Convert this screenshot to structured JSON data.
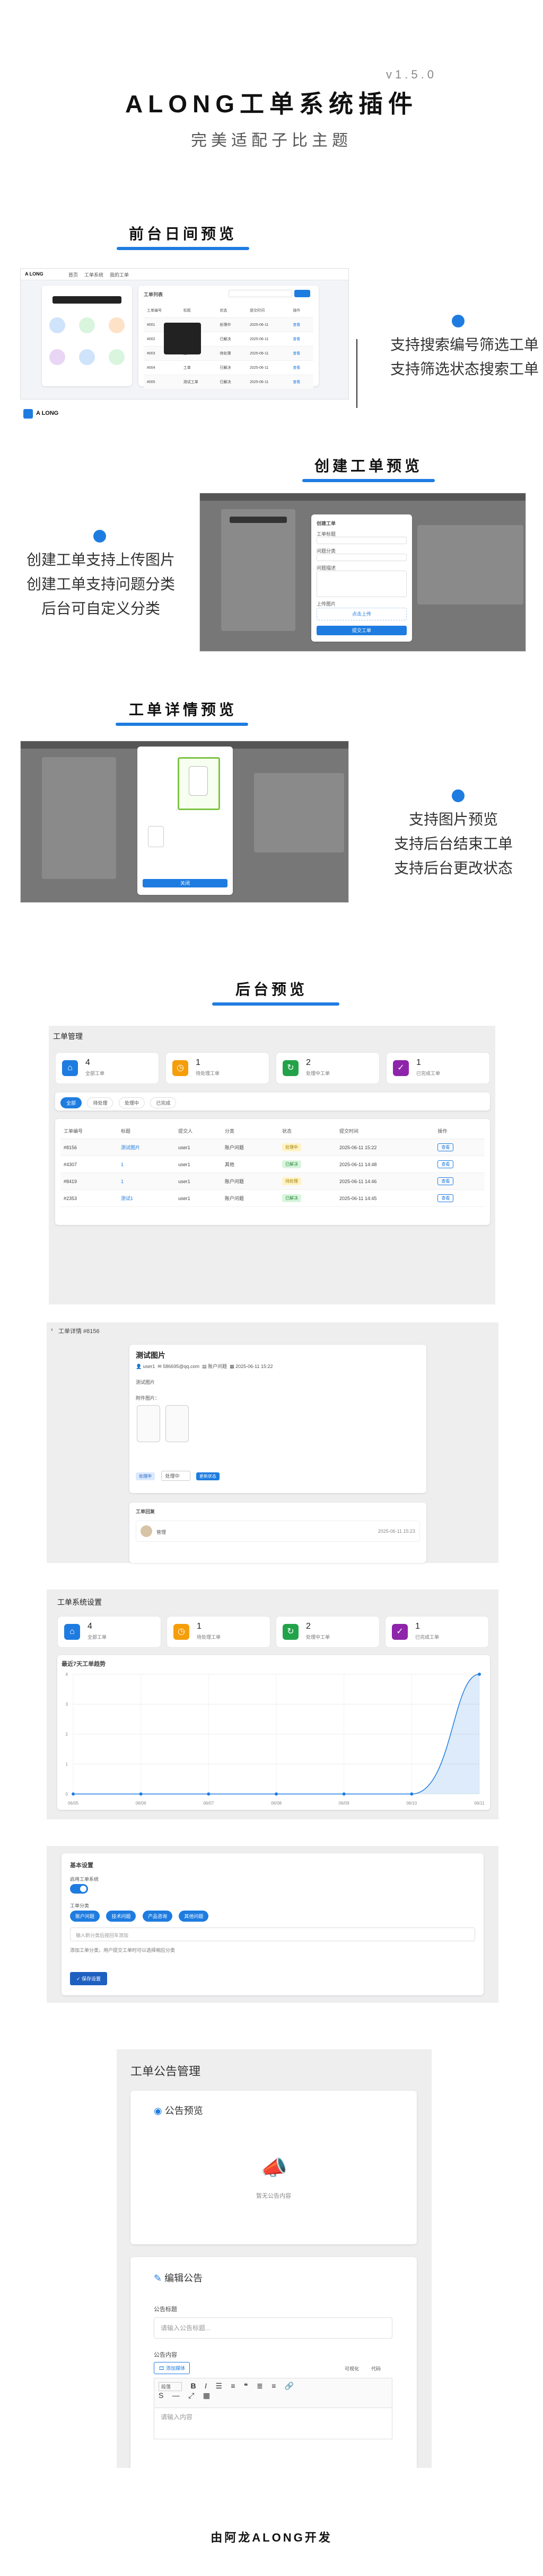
{
  "header": {
    "version": "v1.5.0",
    "title": "ALONG工单系统插件",
    "subtitle": "完美适配子比主题"
  },
  "sections": {
    "frontend": {
      "title": "前台日间预览",
      "features": [
        "支持搜索编号筛选工单",
        "支持筛选状态搜索工单"
      ],
      "shot": {
        "logo": "A LONG",
        "tabs": [
          "首页",
          "工单系统",
          "我的工单"
        ],
        "panel_title": "工单列表",
        "table_headers": [
          "工单编号",
          "标题",
          "状态",
          "提交时间",
          "操作"
        ],
        "rows": [
          [
            "#001",
            "测试工单",
            "处理中",
            "2025-06-11",
            "查看"
          ],
          [
            "#002",
            "工单",
            "已解决",
            "2025-06-11",
            "查看"
          ],
          [
            "#003",
            "工单",
            "待处理",
            "2025-06-11",
            "查看"
          ],
          [
            "#004",
            "工单",
            "已解决",
            "2025-06-11",
            "查看"
          ],
          [
            "#005",
            "测试工单",
            "已解决",
            "2025-06-11",
            "查看"
          ]
        ]
      }
    },
    "create": {
      "title": "创建工单预览",
      "features": [
        "创建工单支持上传图片",
        "创建工单支持问题分类",
        "后台可自定义分类"
      ],
      "shot": {
        "modal_title": "创建工单",
        "field_labels": [
          "工单标题",
          "问题分类",
          "问题描述",
          "上传图片"
        ],
        "upload_label": "点击上传",
        "submit_label": "提交工单"
      }
    },
    "detail": {
      "title": "工单详情预览",
      "features": [
        "支持图片预览",
        "支持后台结束工单",
        "支持后台更改状态"
      ],
      "shot": {
        "close_label": "关闭"
      }
    },
    "backend": {
      "title": "后台预览"
    }
  },
  "admin_manage": {
    "title": "工单管理",
    "stats": [
      {
        "num": "4",
        "label": "全部工单",
        "color": "#1e7ce0",
        "icon": "home-icon"
      },
      {
        "num": "1",
        "label": "待处理工单",
        "color": "#f59e0b",
        "icon": "clock-icon"
      },
      {
        "num": "2",
        "label": "处理中工单",
        "color": "#22a34a",
        "icon": "refresh-icon"
      },
      {
        "num": "1",
        "label": "已完成工单",
        "color": "#8e24aa",
        "icon": "check-icon"
      }
    ],
    "filters": [
      "全部",
      "待处理",
      "处理中",
      "已完成"
    ],
    "table_headers": [
      "工单编号",
      "标题",
      "提交人",
      "分类",
      "状态",
      "提交时间",
      "操作"
    ],
    "rows": [
      {
        "id": "#8156",
        "title": "测试图片",
        "user": "user1",
        "cat": "账户问题",
        "status": "处理中",
        "time": "2025-06-11 15:22",
        "action": "查看"
      },
      {
        "id": "#4307",
        "title": "1",
        "user": "user1",
        "cat": "其他",
        "status": "已解决",
        "time": "2025-06-11 14:48",
        "action": "查看"
      },
      {
        "id": "#8419",
        "title": "1",
        "user": "user1",
        "cat": "账户问题",
        "status": "待处理",
        "time": "2025-06-11 14:46",
        "action": "查看"
      },
      {
        "id": "#2353",
        "title": "测试1",
        "user": "user1",
        "cat": "账户问题",
        "status": "已解决",
        "time": "2025-06-11 14:45",
        "action": "查看"
      }
    ]
  },
  "admin_detail": {
    "title": "工单详情 #8156",
    "ticket_title": "测试图片",
    "meta": [
      "user1",
      "586695@qq.com",
      "账户问题",
      "2025-06-11 15:22"
    ],
    "desc_label": "测试图片",
    "images_label": "附件图片：",
    "status_badge": "处理中",
    "status_select": "处理中",
    "update_button": "更新状态",
    "reply_title": "工单回复",
    "reply_user": "管理",
    "reply_time": "2025-06-11 15:23"
  },
  "admin_settings": {
    "title": "工单系统设置",
    "stats": [
      {
        "num": "4",
        "label": "全部工单",
        "color": "#1e7ce0",
        "icon": "home-icon"
      },
      {
        "num": "1",
        "label": "待处理工单",
        "color": "#f59e0b",
        "icon": "clock-icon"
      },
      {
        "num": "2",
        "label": "处理中工单",
        "color": "#22a34a",
        "icon": "refresh-icon"
      },
      {
        "num": "1",
        "label": "已完成工单",
        "color": "#8e24aa",
        "icon": "check-icon"
      }
    ]
  },
  "chart_data": {
    "type": "area",
    "title": "最近7天工单趋势",
    "x": [
      "06/05",
      "06/06",
      "06/07",
      "06/08",
      "06/09",
      "06/10",
      "06/11"
    ],
    "values": [
      0,
      0,
      0,
      0,
      0,
      0,
      4
    ],
    "ylim": [
      0,
      4
    ],
    "yticks": [
      0,
      1,
      2,
      3,
      4
    ],
    "color": "#1e7ce0",
    "grid": true
  },
  "admin_basic": {
    "title": "基本设置",
    "toggle_label": "启用工单系统",
    "cat_label": "工单分类",
    "categories": [
      "账户问题",
      "技术问题",
      "产品咨询",
      "其他问题"
    ],
    "input_placeholder": "输入新分类后按回车添加",
    "hint": "添加工单分类，用户提交工单时可以选择相应分类",
    "save_button": "保存设置"
  },
  "admin_notice": {
    "title": "工单公告管理",
    "preview_title": "公告预览",
    "empty_text": "暂无公告内容",
    "edit_title": "编辑公告",
    "title_label": "公告标题",
    "title_placeholder": "请输入公告标题...",
    "content_label": "公告内容",
    "media_button": "添加媒体",
    "tab_visual": "可视化",
    "tab_code": "代码",
    "format_select": "段落",
    "content_placeholder": "请输入内容"
  },
  "footer": {
    "text": "由阿龙ALONG开发"
  }
}
